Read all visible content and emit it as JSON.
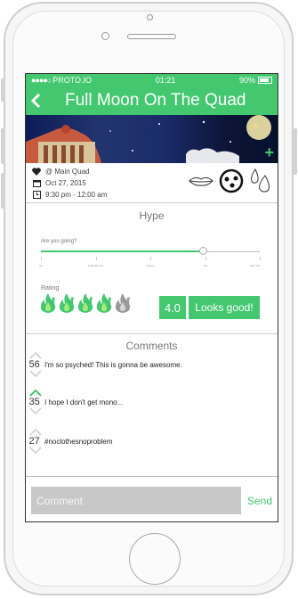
{
  "status_bar": {
    "carrier": "PROTO.IO",
    "time": "01:21",
    "battery": "90%"
  },
  "nav": {
    "title": "Full Moon On The Quad"
  },
  "event": {
    "location": "@ Main Quad",
    "date": "Oct 27, 2015",
    "time_range": "9:30 pm - 12:00 am"
  },
  "reactions": [
    "lips-icon",
    "face-icon",
    "drops-icon"
  ],
  "hype": {
    "title": "Hype",
    "question": "Are you going?",
    "slider_value": 0.74,
    "options": [
      "No",
      "Probably Not",
      "Maybe",
      "Yes",
      "Hell Yes"
    ],
    "rating_label": "Rating",
    "flames_filled": 4,
    "flames_total": 5,
    "score": "4.0",
    "verdict": "Looks good!"
  },
  "comments": {
    "title": "Comments",
    "items": [
      {
        "votes": "56",
        "text": "I'm so psyched! This is gonna be awesome.",
        "upvoted": false
      },
      {
        "votes": "35",
        "text": "I hope I don't get mono...",
        "upvoted": true
      },
      {
        "votes": "27",
        "text": "#noclothesnoproblem",
        "upvoted": false
      }
    ]
  },
  "composer": {
    "placeholder": "Comment",
    "send_label": "Send"
  },
  "colors": {
    "accent": "#43c86f"
  }
}
